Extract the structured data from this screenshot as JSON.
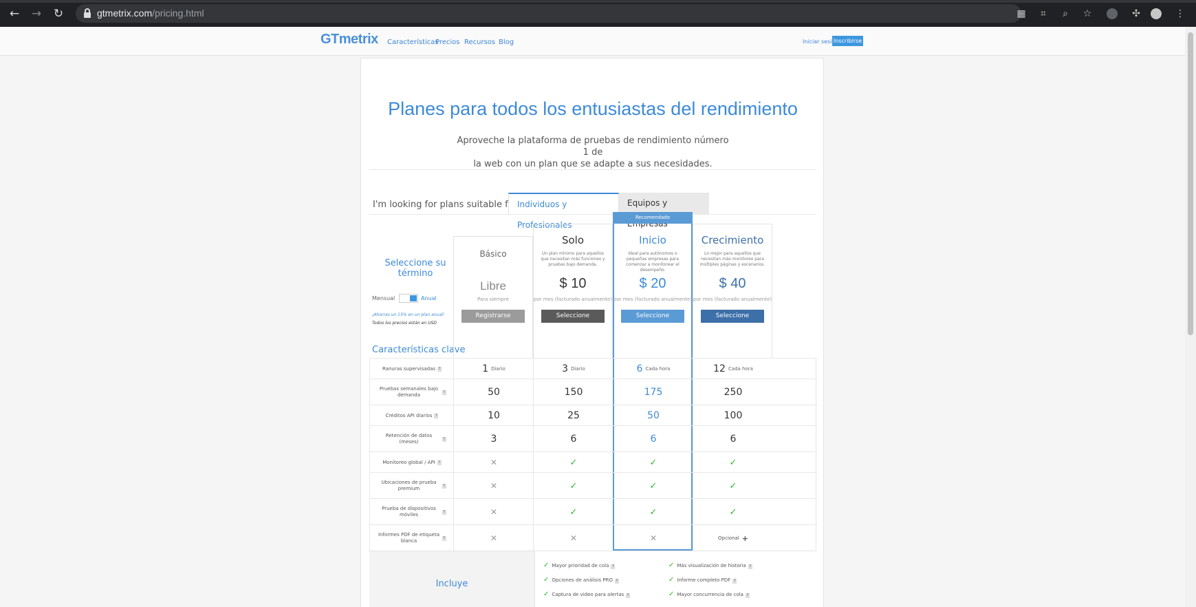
{
  "browser": {
    "url_host": "gtmetrix.com",
    "url_path": "/pricing.html"
  },
  "header": {
    "logo": "GTmetrix",
    "nav": [
      "Características",
      "Precios",
      "Recursos",
      "Blog"
    ],
    "login": "Iniciar sesión",
    "signup": "Inscribirse"
  },
  "hero": {
    "title": "Planes para todos los entusiastas del rendimiento",
    "subtitle_line1": "Aproveche la plataforma de pruebas de rendimiento número 1 de",
    "subtitle_line2": "la web con un plan que se adapte a sus necesidades."
  },
  "tabs": {
    "prompt": "I'm looking for plans suitable for",
    "active": "Individuos y Profesionales",
    "inactive": "Equipos y Empresas"
  },
  "term": {
    "title": "Seleccione su término",
    "monthly": "Mensual",
    "annual": "Anual",
    "save_note": "¡Ahorras un 15% en un plan anual!",
    "usd_note": "Todos los precios están en USD",
    "key_features": "Características clave"
  },
  "recommended_label": "Recomendado",
  "plans": [
    {
      "name": "Básico",
      "desc": "",
      "price": "Libre",
      "per": "Para siempre",
      "button": "Registrarse",
      "button_color": "#9b9b9b"
    },
    {
      "name": "Solo",
      "desc": "Un plan mínimo para aquellos que necesitan más funciones y pruebas bajo demanda.",
      "price": "$ 10",
      "per": "por mes (facturado anualmente)",
      "button": "Seleccione",
      "button_color": "#5a5a5a"
    },
    {
      "name": "Inicio",
      "desc": "Ideal para autónomos o pequeñas empresas para comenzar a monitorear el desempeño.",
      "price": "$ 20",
      "per": "por mes (facturado anualmente)",
      "button": "Seleccione",
      "button_color": "#5b9bd5"
    },
    {
      "name": "Crecimiento",
      "desc": "Lo mejor para aquellos que necesitan más monitoreo para múltiples páginas y escenarios.",
      "price": "$ 40",
      "per": "por mes (facturado anualmente)",
      "button": "Seleccione",
      "button_color": "#3d6fa8"
    }
  ],
  "features": [
    {
      "label": "Ranuras supervisadas",
      "values": [
        {
          "v": "1",
          "u": "Diario"
        },
        {
          "v": "3",
          "u": "Diario"
        },
        {
          "v": "6",
          "u": "Cada hora"
        },
        {
          "v": "12",
          "u": "Cada hora"
        }
      ]
    },
    {
      "label": "Pruebas semanales bajo demanda",
      "values": [
        {
          "v": "50"
        },
        {
          "v": "150"
        },
        {
          "v": "175"
        },
        {
          "v": "250"
        }
      ]
    },
    {
      "label": "Créditos API diarios",
      "values": [
        {
          "v": "10"
        },
        {
          "v": "25"
        },
        {
          "v": "50"
        },
        {
          "v": "100"
        }
      ]
    },
    {
      "label": "Retención de datos (meses)",
      "values": [
        {
          "v": "3"
        },
        {
          "v": "6"
        },
        {
          "v": "6"
        },
        {
          "v": "6"
        }
      ]
    },
    {
      "label": "Monitoreo global / API",
      "values": [
        {
          "icon": "cross"
        },
        {
          "icon": "check"
        },
        {
          "icon": "check"
        },
        {
          "icon": "check"
        }
      ]
    },
    {
      "label": "Ubicaciones de prueba premium",
      "values": [
        {
          "icon": "cross"
        },
        {
          "icon": "check"
        },
        {
          "icon": "check"
        },
        {
          "icon": "check"
        }
      ]
    },
    {
      "label": "Prueba de dispositivos móviles",
      "values": [
        {
          "icon": "cross"
        },
        {
          "icon": "check"
        },
        {
          "icon": "check"
        },
        {
          "icon": "check"
        }
      ]
    },
    {
      "label": "Informes PDF de etiqueta blanca",
      "values": [
        {
          "icon": "cross"
        },
        {
          "icon": "cross"
        },
        {
          "icon": "cross"
        },
        {
          "v": "Opcional",
          "plus": true
        }
      ]
    }
  ],
  "includes": {
    "label": "Incluye",
    "items": [
      "Mayor prioridad de cola",
      "Más visualización de historia",
      "Opciones de análisis PRO",
      "Informe completo PDF",
      "Captura de video para alertas",
      "Mayor concurrencia de cola"
    ]
  },
  "colors": {
    "accent": "#3d8ad8",
    "recommended": "#5b9bd5",
    "check": "#2eb82e"
  }
}
